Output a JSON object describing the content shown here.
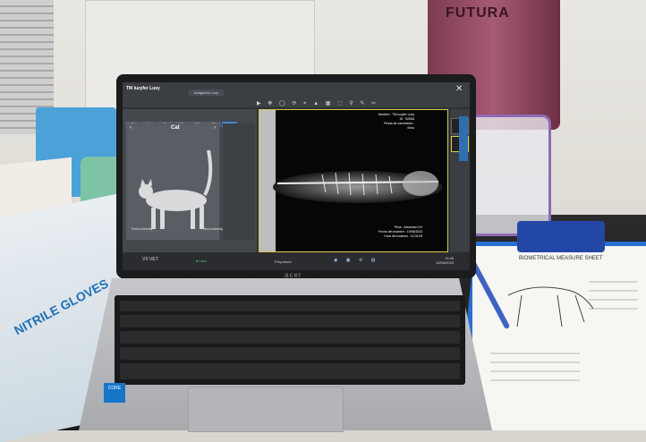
{
  "scene": {
    "flask_brand": "FUTURA",
    "glove_box_text": "NITRILE GLOVES",
    "laptop_brand": "acer",
    "sticker_text": "CORE",
    "paper_title": "BIOMETRICAL MEASURE SHEET"
  },
  "app": {
    "patient_name": "TM luzyfer Luey",
    "tab_label": "Imágenes Luzy",
    "toolbar_icons": "▶ ✥ ◯ ⟳ ⌖ ▲ ▦ ⬚ ⚲ ✎ ✂",
    "close_glyph": "✕",
    "positions": [
      "Dr",
      "L",
      "Cr",
      "Cd",
      "VD",
      "DV",
      "Mnpuso"
    ],
    "species": "Cat",
    "prev_glyph": "‹",
    "next_glyph": "›",
    "front_label": "Front extremity",
    "hind_label": "Hind extremity",
    "info_top": [
      "Nombre : TM luzyfer Luey",
      "ID : 9260A",
      "Fecha de nacimiento :",
      "Sexo"
    ],
    "info_bottom": [
      "Peso : Abdomen DV",
      "Fecha del examen : 19/06/2023",
      "Hora del examen : 11:04:09"
    ],
    "logo": "VX VET",
    "status_ok": "● Listo",
    "status_mid": "Preparado",
    "taskbar_icons": "◉ ▣ ⚙ ▤",
    "clock_time": "11:06",
    "clock_date": "19/06/2023"
  }
}
